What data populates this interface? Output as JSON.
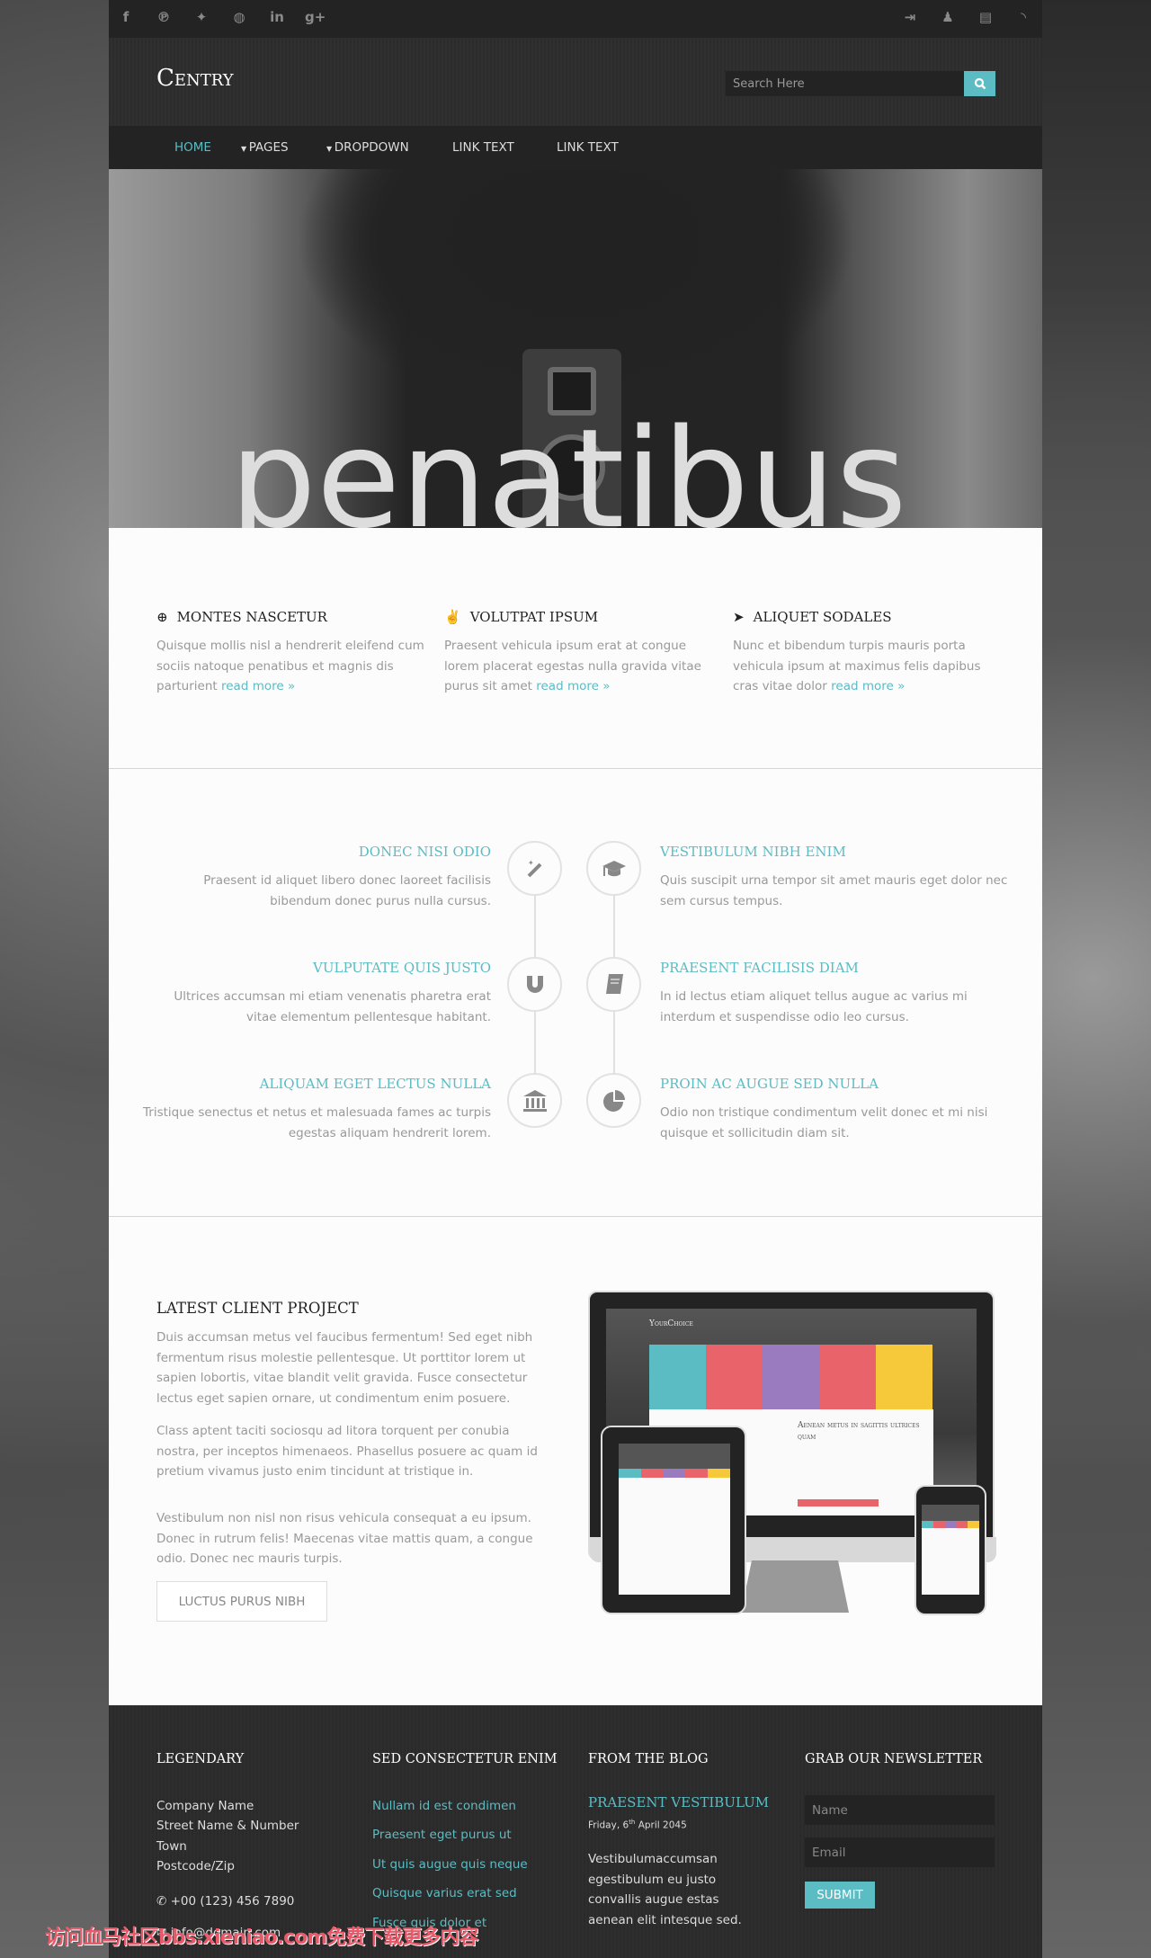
{
  "topbar": {
    "social_icons": [
      "facebook-icon",
      "pinterest-icon",
      "twitter-icon",
      "dribbble-icon",
      "linkedin-icon",
      "google-plus-icon"
    ],
    "account_icons": [
      "sign-in-icon",
      "add-user-icon",
      "newspaper-icon",
      "rss-icon"
    ]
  },
  "header": {
    "logo": "Centry",
    "search_placeholder": "Search Here",
    "search_icon": "search-icon"
  },
  "nav": {
    "items": [
      {
        "label": "HOME",
        "active": true
      },
      {
        "label": "PAGES",
        "dropdown": true
      },
      {
        "label": "DROPDOWN",
        "dropdown": true
      },
      {
        "label": "LINK TEXT"
      },
      {
        "label": "LINK TEXT"
      }
    ]
  },
  "hero": {
    "title": "penatibus"
  },
  "features": [
    {
      "icon": "life-ring-icon",
      "title": "MONTES NASCETUR",
      "text": "Quisque mollis nisl a hendrerit eleifend cum sociis natoque penatibus et magnis dis parturient ",
      "link": "read more »"
    },
    {
      "icon": "peace-hand-icon",
      "title": "VOLUTPAT IPSUM",
      "text": "Praesent vehicula ipsum erat at congue lorem placerat egestas nulla gravida vitae purus sit amet ",
      "link": "read more »"
    },
    {
      "icon": "location-arrow-icon",
      "title": "ALIQUET SODALES",
      "text": "Nunc et bibendum turpis mauris porta vehicula ipsum at maximus felis dapibus cras vitae dolor ",
      "link": "read more »"
    }
  ],
  "timeline": {
    "left": [
      {
        "icon": "magic-wand-icon",
        "title": "DONEC NISI ODIO",
        "text": "Praesent id aliquet libero donec laoreet facilisis bibendum donec purus nulla cursus."
      },
      {
        "icon": "magnet-icon",
        "title": "VULPUTATE QUIS JUSTO",
        "text": "Ultrices accumsan mi etiam venenatis pharetra erat vitae elementum pellentesque habitant."
      },
      {
        "icon": "bank-icon",
        "title": "ALIQUAM EGET LECTUS NULLA",
        "text": "Tristique senectus et netus et malesuada fames ac turpis egestas aliquam hendrerit lorem."
      }
    ],
    "right": [
      {
        "icon": "graduation-cap-icon",
        "title": "VESTIBULUM NIBH ENIM",
        "text": "Quis suscipit urna tempor sit amet mauris eget dolor nec sem cursus tempus."
      },
      {
        "icon": "book-icon",
        "title": "PRAESENT FACILISIS DIAM",
        "text": "In id lectus etiam aliquet tellus augue ac varius mi interdum et suspendisse odio leo cursus."
      },
      {
        "icon": "pie-chart-icon",
        "title": "PROIN AC AUGUE SED NULLA",
        "text": "Odio non tristique condimentum velit donec et mi nisi quisque et sollicitudin diam sit."
      }
    ]
  },
  "project": {
    "title": "LATEST CLIENT PROJECT",
    "paragraphs": [
      "Duis accumsan metus vel faucibus fermentum! Sed eget nibh fermentum risus molestie pellentesque. Ut porttitor lorem ut sapien lobortis, vitae blandit velit gravida. Fusce consectetur lectus eget sapien ornare, ut condimentum enim posuere.",
      "Class aptent taciti sociosqu ad litora torquent per conubia nostra, per inceptos himenaeos. Phasellus posuere ac quam id pretium vivamus justo enim tincidunt at tristique in.",
      "Vestibulum non nisl non risus vehicula consequat a eu ipsum. Donec in rutrum felis! Maecenas vitae mattis quam, a congue odio. Donec nec mauris turpis."
    ],
    "button": "LUCTUS PURUS NIBH",
    "mockup": {
      "logo": "YourChoice",
      "heading": "Aenean metus in sagittis ultrices quam",
      "tile_colors": [
        "#5bbcc4",
        "#e9646a",
        "#9b7bc0",
        "#e9646a",
        "#f5c93a"
      ]
    }
  },
  "footer": {
    "col1": {
      "title": "LEGENDARY",
      "address": [
        "Company Name",
        "Street Name & Number",
        "Town",
        "Postcode/Zip"
      ],
      "phone": "+00 (123) 456 7890",
      "email": "info@domain.com"
    },
    "col2": {
      "title": "SED CONSECTETUR ENIM",
      "links": [
        "Nullam id est condimen",
        "Praesent eget purus ut",
        "Ut quis augue quis neque",
        "Quisque varius erat sed",
        "Fusce quis dolor et"
      ]
    },
    "col3": {
      "title": "FROM THE BLOG",
      "post_title": "PRAESENT VESTIBULUM",
      "date_prefix": "Friday, 6",
      "date_sup": "th",
      "date_suffix": " April 2045",
      "text": "Vestibulumaccumsan egestibulum eu justo convallis augue estas aenean elit intesque sed."
    },
    "col4": {
      "title": "GRAB OUR NEWSLETTER",
      "name_placeholder": "Name",
      "email_placeholder": "Email",
      "submit": "SUBMIT"
    }
  },
  "watermark": "访问血马社区bbs.xieniao.com免费下载更多内容",
  "colors": {
    "accent": "#5bbcc4",
    "dark": "#232323",
    "body_text": "#999999"
  }
}
